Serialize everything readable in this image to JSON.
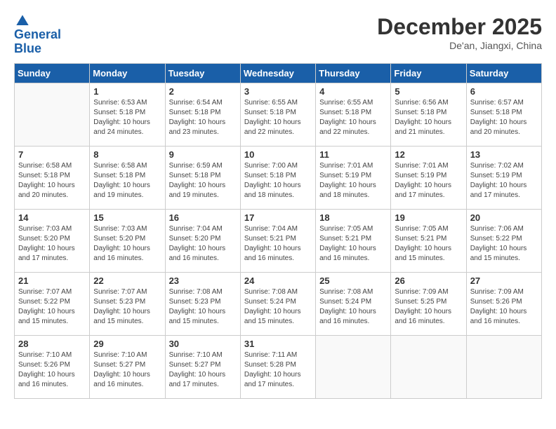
{
  "logo": {
    "line1": "General",
    "line2": "Blue"
  },
  "title": "December 2025",
  "subtitle": "De'an, Jiangxi, China",
  "days_of_week": [
    "Sunday",
    "Monday",
    "Tuesday",
    "Wednesday",
    "Thursday",
    "Friday",
    "Saturday"
  ],
  "weeks": [
    [
      {
        "day": "",
        "info": ""
      },
      {
        "day": "1",
        "info": "Sunrise: 6:53 AM\nSunset: 5:18 PM\nDaylight: 10 hours and 24 minutes."
      },
      {
        "day": "2",
        "info": "Sunrise: 6:54 AM\nSunset: 5:18 PM\nDaylight: 10 hours and 23 minutes."
      },
      {
        "day": "3",
        "info": "Sunrise: 6:55 AM\nSunset: 5:18 PM\nDaylight: 10 hours and 22 minutes."
      },
      {
        "day": "4",
        "info": "Sunrise: 6:55 AM\nSunset: 5:18 PM\nDaylight: 10 hours and 22 minutes."
      },
      {
        "day": "5",
        "info": "Sunrise: 6:56 AM\nSunset: 5:18 PM\nDaylight: 10 hours and 21 minutes."
      },
      {
        "day": "6",
        "info": "Sunrise: 6:57 AM\nSunset: 5:18 PM\nDaylight: 10 hours and 20 minutes."
      }
    ],
    [
      {
        "day": "7",
        "info": "Sunrise: 6:58 AM\nSunset: 5:18 PM\nDaylight: 10 hours and 20 minutes."
      },
      {
        "day": "8",
        "info": "Sunrise: 6:58 AM\nSunset: 5:18 PM\nDaylight: 10 hours and 19 minutes."
      },
      {
        "day": "9",
        "info": "Sunrise: 6:59 AM\nSunset: 5:18 PM\nDaylight: 10 hours and 19 minutes."
      },
      {
        "day": "10",
        "info": "Sunrise: 7:00 AM\nSunset: 5:18 PM\nDaylight: 10 hours and 18 minutes."
      },
      {
        "day": "11",
        "info": "Sunrise: 7:01 AM\nSunset: 5:19 PM\nDaylight: 10 hours and 18 minutes."
      },
      {
        "day": "12",
        "info": "Sunrise: 7:01 AM\nSunset: 5:19 PM\nDaylight: 10 hours and 17 minutes."
      },
      {
        "day": "13",
        "info": "Sunrise: 7:02 AM\nSunset: 5:19 PM\nDaylight: 10 hours and 17 minutes."
      }
    ],
    [
      {
        "day": "14",
        "info": "Sunrise: 7:03 AM\nSunset: 5:20 PM\nDaylight: 10 hours and 17 minutes."
      },
      {
        "day": "15",
        "info": "Sunrise: 7:03 AM\nSunset: 5:20 PM\nDaylight: 10 hours and 16 minutes."
      },
      {
        "day": "16",
        "info": "Sunrise: 7:04 AM\nSunset: 5:20 PM\nDaylight: 10 hours and 16 minutes."
      },
      {
        "day": "17",
        "info": "Sunrise: 7:04 AM\nSunset: 5:21 PM\nDaylight: 10 hours and 16 minutes."
      },
      {
        "day": "18",
        "info": "Sunrise: 7:05 AM\nSunset: 5:21 PM\nDaylight: 10 hours and 16 minutes."
      },
      {
        "day": "19",
        "info": "Sunrise: 7:05 AM\nSunset: 5:21 PM\nDaylight: 10 hours and 15 minutes."
      },
      {
        "day": "20",
        "info": "Sunrise: 7:06 AM\nSunset: 5:22 PM\nDaylight: 10 hours and 15 minutes."
      }
    ],
    [
      {
        "day": "21",
        "info": "Sunrise: 7:07 AM\nSunset: 5:22 PM\nDaylight: 10 hours and 15 minutes."
      },
      {
        "day": "22",
        "info": "Sunrise: 7:07 AM\nSunset: 5:23 PM\nDaylight: 10 hours and 15 minutes."
      },
      {
        "day": "23",
        "info": "Sunrise: 7:08 AM\nSunset: 5:23 PM\nDaylight: 10 hours and 15 minutes."
      },
      {
        "day": "24",
        "info": "Sunrise: 7:08 AM\nSunset: 5:24 PM\nDaylight: 10 hours and 15 minutes."
      },
      {
        "day": "25",
        "info": "Sunrise: 7:08 AM\nSunset: 5:24 PM\nDaylight: 10 hours and 16 minutes."
      },
      {
        "day": "26",
        "info": "Sunrise: 7:09 AM\nSunset: 5:25 PM\nDaylight: 10 hours and 16 minutes."
      },
      {
        "day": "27",
        "info": "Sunrise: 7:09 AM\nSunset: 5:26 PM\nDaylight: 10 hours and 16 minutes."
      }
    ],
    [
      {
        "day": "28",
        "info": "Sunrise: 7:10 AM\nSunset: 5:26 PM\nDaylight: 10 hours and 16 minutes."
      },
      {
        "day": "29",
        "info": "Sunrise: 7:10 AM\nSunset: 5:27 PM\nDaylight: 10 hours and 16 minutes."
      },
      {
        "day": "30",
        "info": "Sunrise: 7:10 AM\nSunset: 5:27 PM\nDaylight: 10 hours and 17 minutes."
      },
      {
        "day": "31",
        "info": "Sunrise: 7:11 AM\nSunset: 5:28 PM\nDaylight: 10 hours and 17 minutes."
      },
      {
        "day": "",
        "info": ""
      },
      {
        "day": "",
        "info": ""
      },
      {
        "day": "",
        "info": ""
      }
    ]
  ]
}
